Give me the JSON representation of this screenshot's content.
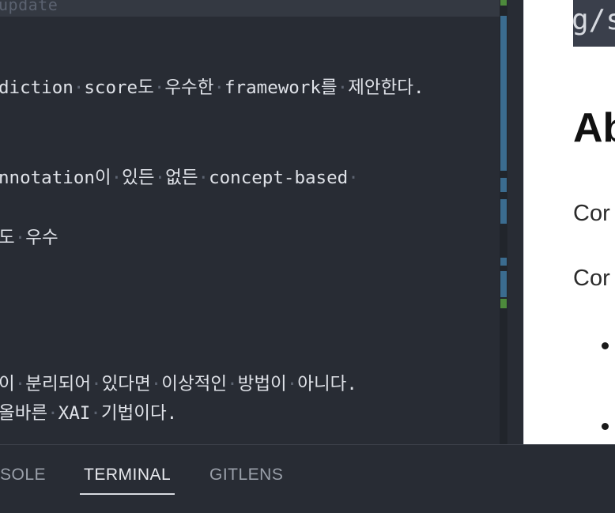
{
  "editor": {
    "top_faded": "update",
    "lines": [
      {
        "segments": [
          [
            "diction",
            0
          ],
          [
            "·",
            1
          ],
          [
            "score도",
            0
          ],
          [
            "·",
            1
          ],
          [
            "우수한",
            0
          ],
          [
            "·",
            1
          ],
          [
            "framework를",
            0
          ],
          [
            "·",
            1
          ],
          [
            "제안한다.",
            0
          ]
        ]
      },
      {
        "segments": [
          [
            "nnotation이",
            0
          ],
          [
            "·",
            1
          ],
          [
            "있든",
            0
          ],
          [
            "·",
            1
          ],
          [
            "없든",
            0
          ],
          [
            "·",
            1
          ],
          [
            "concept-based",
            0
          ],
          [
            "·",
            1
          ]
        ]
      },
      {
        "segments": [
          [
            "도",
            0
          ],
          [
            "·",
            1
          ],
          [
            "우수",
            0
          ]
        ]
      },
      {
        "segments": [
          [
            "이",
            0
          ],
          [
            "·",
            1
          ],
          [
            "분리되어",
            0
          ],
          [
            "·",
            1
          ],
          [
            "있다면",
            0
          ],
          [
            "·",
            1
          ],
          [
            "이상적인",
            0
          ],
          [
            "·",
            1
          ],
          [
            "방법이",
            0
          ],
          [
            "·",
            1
          ],
          [
            "아니다.",
            0
          ]
        ]
      },
      {
        "segments": [
          [
            "올바른",
            0
          ],
          [
            "·",
            1
          ],
          [
            "XAI",
            0
          ],
          [
            "·",
            1
          ],
          [
            "기법이다.",
            0
          ]
        ]
      }
    ],
    "colors": {
      "background": "#282c34",
      "text": "#dfe2e8",
      "whitespace": "#5c6370"
    }
  },
  "scrollbar": {
    "marks": [
      {
        "color": "#4d8a3c"
      },
      {
        "color": "#3b6c8f"
      },
      {
        "color": "#3b6c8f"
      },
      {
        "color": "#3b6c8f"
      },
      {
        "color": "#3b6c8f"
      },
      {
        "color": "#3b6c8f"
      },
      {
        "color": "#4d8a3c"
      }
    ]
  },
  "preview": {
    "code_text": "g/s",
    "heading": "Ab",
    "paragraphs": [
      "Cor",
      "Cor"
    ]
  },
  "panel": {
    "tabs": [
      {
        "label": "SOLE",
        "active": false
      },
      {
        "label": "TERMINAL",
        "active": true
      },
      {
        "label": "GITLENS",
        "active": false
      }
    ]
  }
}
